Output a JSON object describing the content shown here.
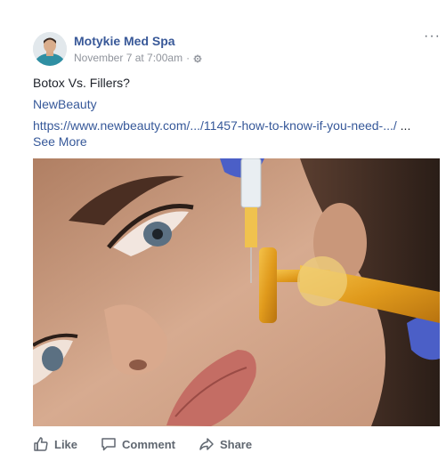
{
  "post": {
    "page_name": "Motykie Med Spa",
    "timestamp": "November 7 at 7:00am",
    "separator": "·",
    "privacy_icon": "gear-icon",
    "options_icon": "more-options-icon",
    "options_glyph": "···",
    "text": "Botox Vs. Fillers?",
    "link": {
      "source": "NewBeauty",
      "url": "https://www.newbeauty.com/.../11457-how-to-know-if-you-need-.../",
      "ellipsis": "...",
      "see_more": "See More"
    },
    "image_icon": "photo"
  },
  "actions": {
    "like": {
      "label": "Like",
      "icon": "like-icon"
    },
    "comment": {
      "label": "Comment",
      "icon": "comment-icon"
    },
    "share": {
      "label": "Share",
      "icon": "share-icon"
    }
  },
  "colors": {
    "link_blue": "#385898",
    "meta_gray": "#90949c",
    "text": "#1d2129",
    "action_gray": "#606770"
  }
}
